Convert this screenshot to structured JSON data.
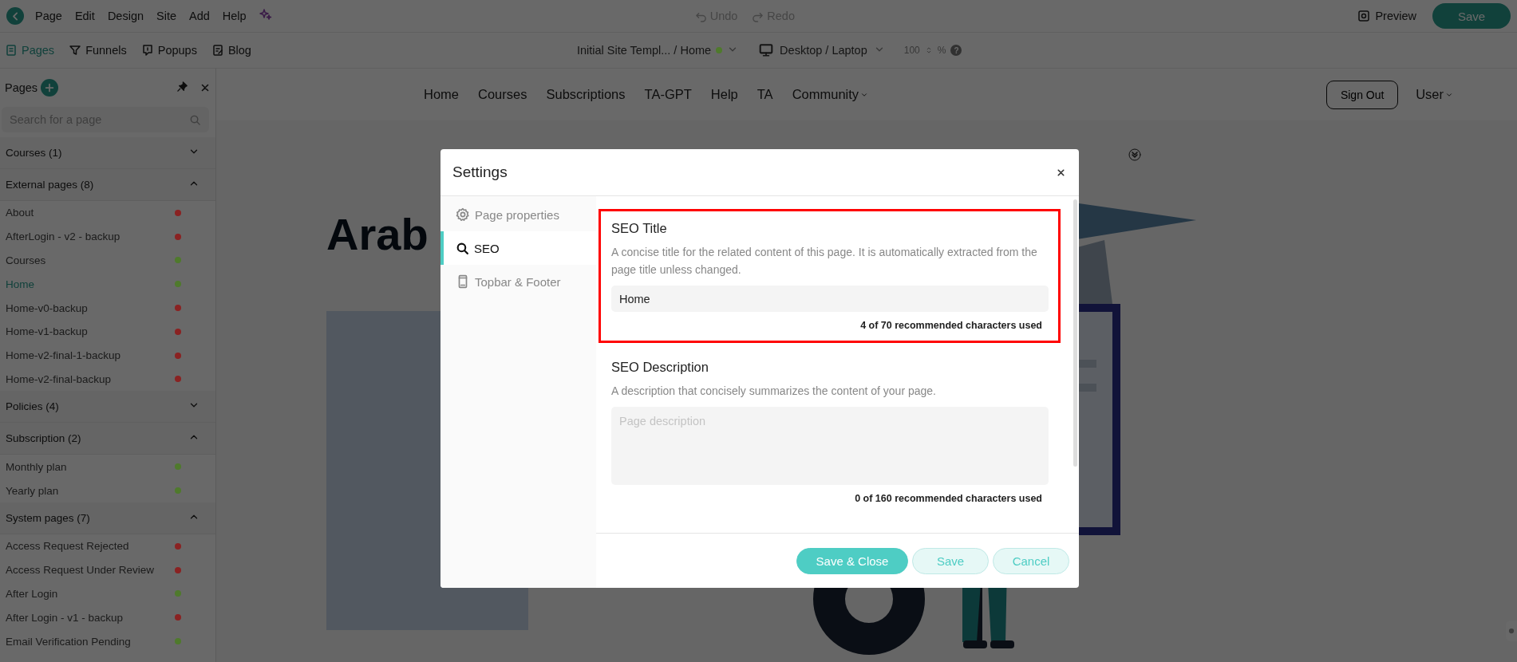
{
  "menu": [
    "Page",
    "Edit",
    "Design",
    "Site",
    "Add",
    "Help"
  ],
  "history": [
    {
      "label": "Undo",
      "disabled": true,
      "kind": "undo"
    },
    {
      "label": "Redo",
      "disabled": true,
      "kind": "redo"
    }
  ],
  "preview": "Preview",
  "save": "Save",
  "tabs": [
    {
      "label": "Pages",
      "selected": true,
      "kind": "pages"
    },
    {
      "label": "Funnels",
      "selected": false,
      "kind": "funnels"
    },
    {
      "label": "Popups",
      "selected": false,
      "kind": "popups"
    },
    {
      "label": "Blog",
      "selected": false,
      "kind": "blog"
    }
  ],
  "site": {
    "name": "Initial Site Templ... / Home",
    "color": "#4f7a2c"
  },
  "device": "Desktop / Laptop",
  "zoom": {
    "value": "100",
    "unit": "%",
    "help": "?"
  },
  "sidebar": {
    "title": "Pages",
    "search_placeholder": "Search for a page",
    "groups": [
      {
        "label": "Courses (1)",
        "expanded": false
      },
      {
        "label": "External pages (8)",
        "expanded": true,
        "items": [
          {
            "label": "About",
            "color": "#8a2222",
            "selected": false
          },
          {
            "label": "AfterLogin - v2 - backup",
            "color": "#8a2222",
            "selected": false
          },
          {
            "label": "Courses",
            "color": "#4f7a2c",
            "selected": false
          },
          {
            "label": "Home",
            "color": "#4f7a2c",
            "selected": true
          },
          {
            "label": "Home-v0-backup",
            "color": "#8a2222",
            "selected": false
          },
          {
            "label": "Home-v1-backup",
            "color": "#8a2222",
            "selected": false
          },
          {
            "label": "Home-v2-final-1-backup",
            "color": "#8a2222",
            "selected": false
          },
          {
            "label": "Home-v2-final-backup",
            "color": "#8a2222",
            "selected": false
          }
        ]
      },
      {
        "label": "Policies (4)",
        "expanded": false
      },
      {
        "label": "Subscription (2)",
        "expanded": true,
        "items": [
          {
            "label": "Monthly plan",
            "color": "#4f7a2c",
            "selected": false
          },
          {
            "label": "Yearly plan",
            "color": "#4f7a2c",
            "selected": false
          }
        ]
      },
      {
        "label": "System pages (7)",
        "expanded": true,
        "items": [
          {
            "label": "Access Request Rejected",
            "color": "#8a2222",
            "selected": false
          },
          {
            "label": "Access Request Under Review",
            "color": "#8a2222",
            "selected": false
          },
          {
            "label": "After Login",
            "color": "#4f7a2c",
            "selected": false
          },
          {
            "label": "After Login - v1 - backup",
            "color": "#8a2222",
            "selected": false
          },
          {
            "label": "Email Verification Pending",
            "color": "#4f7a2c",
            "selected": false
          }
        ]
      }
    ]
  },
  "site_nav": [
    {
      "label": "Home",
      "dropdown": false
    },
    {
      "label": "Courses",
      "dropdown": false
    },
    {
      "label": "Subscriptions",
      "dropdown": false
    },
    {
      "label": "TA-GPT",
      "dropdown": false
    },
    {
      "label": "Help",
      "dropdown": false
    },
    {
      "label": "TA",
      "dropdown": false
    },
    {
      "label": "Community",
      "dropdown": true
    }
  ],
  "sign_out": "Sign Out",
  "user": {
    "label": "User",
    "dropdown": true
  },
  "hero": {
    "heading": "Arab"
  },
  "modal": {
    "title": "Settings",
    "nav": [
      {
        "label": "Page properties",
        "kind": "gear",
        "selected": false
      },
      {
        "label": "SEO",
        "kind": "search",
        "selected": true
      },
      {
        "label": "Topbar & Footer",
        "kind": "phone",
        "selected": false
      }
    ],
    "sections": [
      {
        "title": "SEO Title",
        "description": "A concise title for the related content of this page. It is automatically extracted from the page title unless changed.",
        "kind": "input",
        "value": "Home",
        "counter": "4 of 70 recommended characters used",
        "highlighted": true
      },
      {
        "title": "SEO Description",
        "description": "A description that concisely summarizes the content of your page.",
        "kind": "textarea",
        "placeholder": "Page description",
        "counter": "0 of 160 recommended characters used",
        "highlighted": false
      }
    ],
    "buttons": [
      {
        "label": "Save & Close",
        "primary": true
      },
      {
        "label": "Save",
        "primary": false
      },
      {
        "label": "Cancel",
        "primary": false
      }
    ]
  }
}
